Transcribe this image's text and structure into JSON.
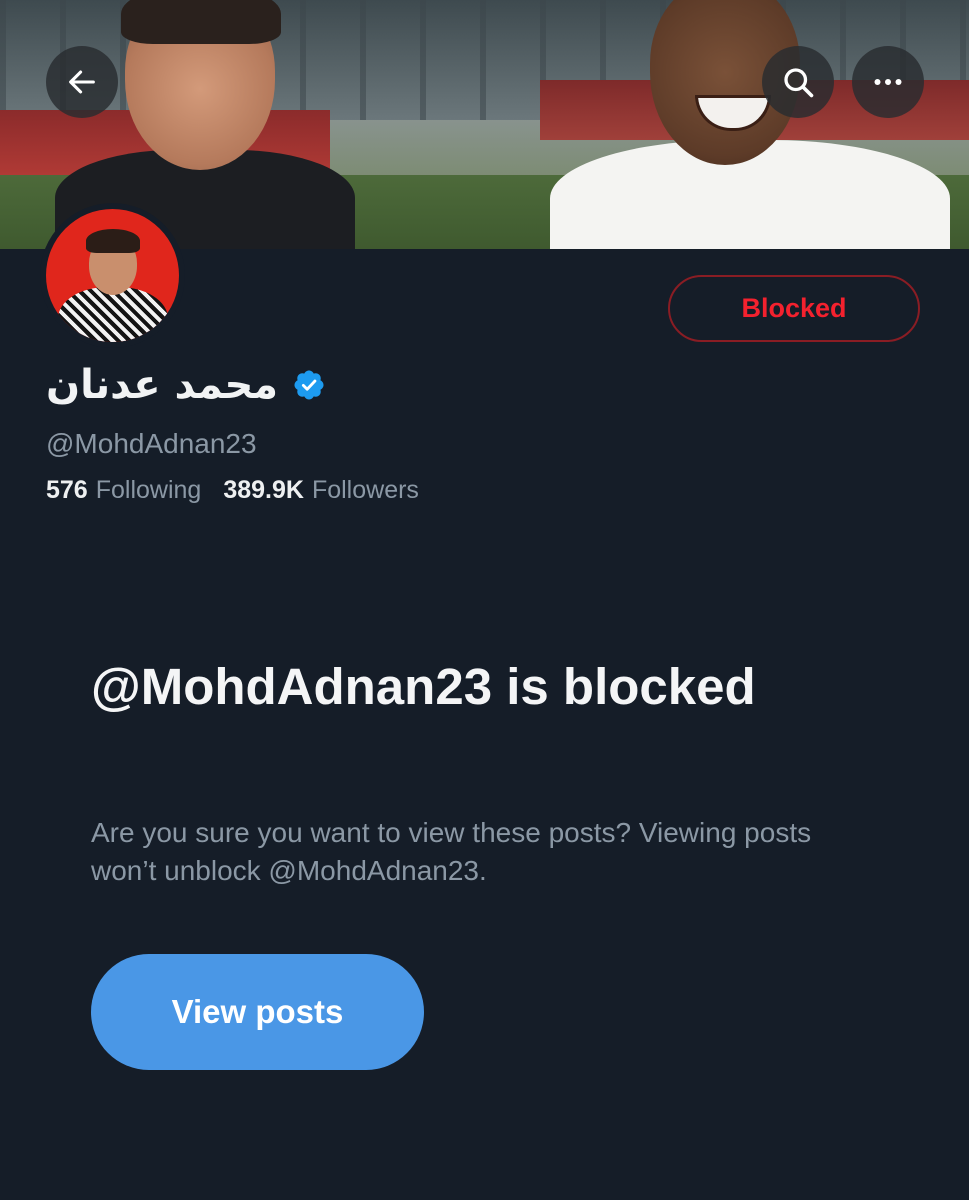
{
  "header": {
    "back_icon": "arrow-left-icon",
    "search_icon": "search-icon",
    "more_icon": "more-horizontal-icon"
  },
  "profile": {
    "display_name": "محمد عدنان",
    "verified": true,
    "verified_color": "#1d9bf0",
    "handle": "@MohdAdnan23",
    "following_count": "576",
    "following_label": "Following",
    "followers_count": "389.9K",
    "followers_label": "Followers",
    "blocked_button_label": "Blocked",
    "blocked_color": "#f4212e"
  },
  "block_notice": {
    "title": "@MohdAdnan23 is blocked",
    "description": "Are you sure you want to view these posts? Viewing posts won’t unblock @MohdAdnan23.",
    "view_button_label": "View posts",
    "accent_color": "#4a97e6"
  }
}
